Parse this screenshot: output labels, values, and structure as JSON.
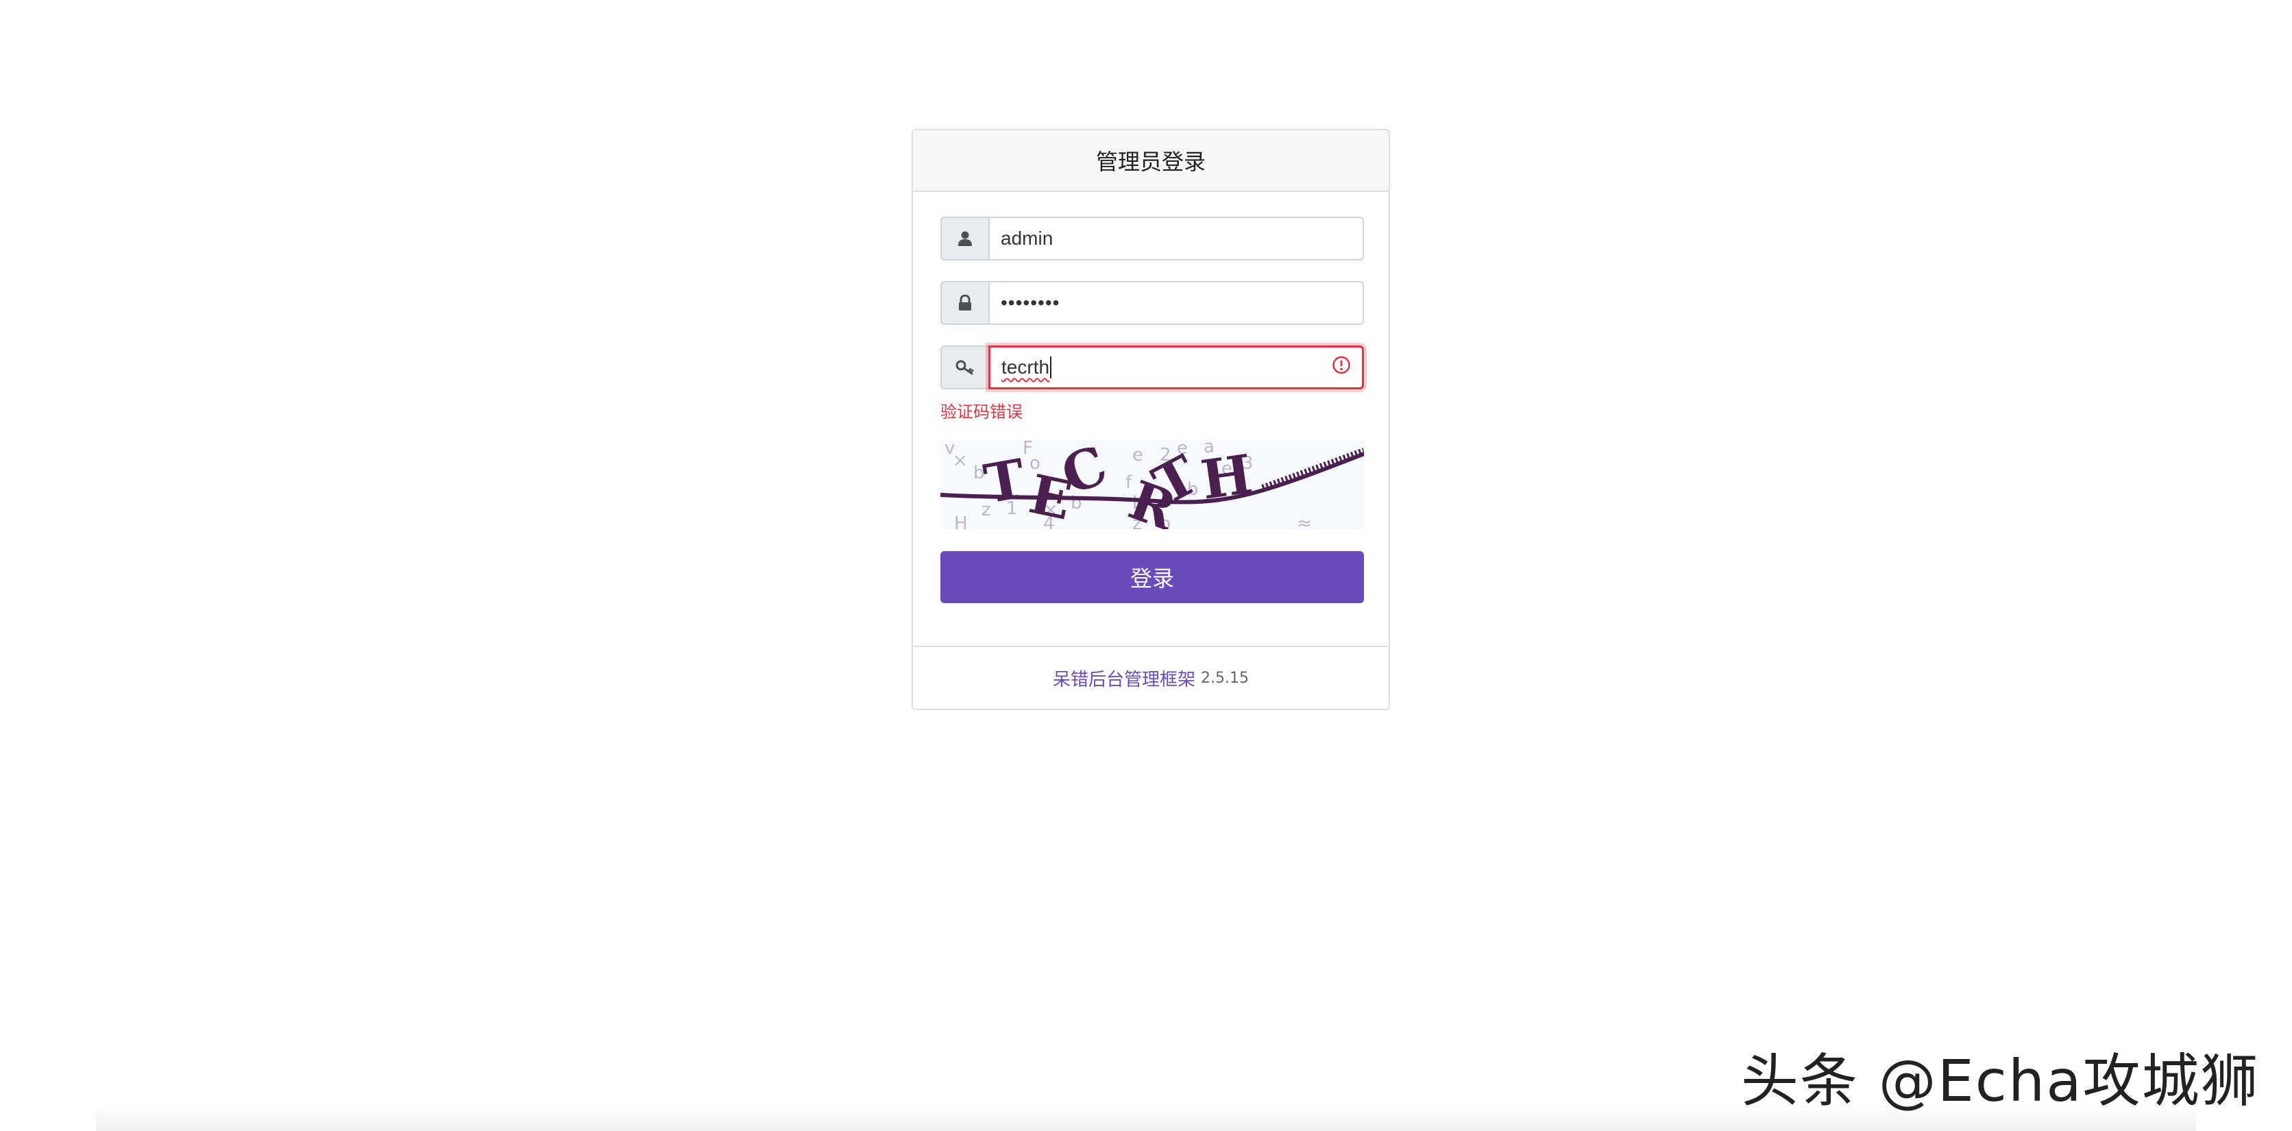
{
  "login": {
    "title": "管理员登录",
    "username_value": "admin",
    "password_value": "••••••••",
    "captcha_value": "tecrth",
    "captcha_error": "验证码错误",
    "captcha_image_text": "TECRTH",
    "submit_label": "登录"
  },
  "footer": {
    "framework_link": "呆错后台管理框架",
    "version": "2.5.15"
  },
  "watermark": {
    "text": "头条 @Echa攻城狮"
  },
  "icons": {
    "username": "user-icon",
    "password": "lock-icon",
    "captcha": "key-icon",
    "invalid": "alert-circle-icon"
  },
  "colors": {
    "accent": "#6a4bbc",
    "error": "#dc3545",
    "captcha_text": "#4b1f4f"
  }
}
